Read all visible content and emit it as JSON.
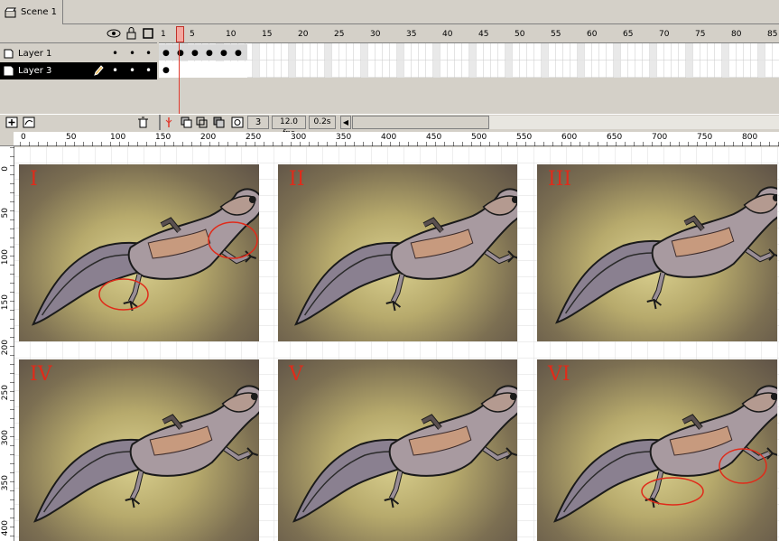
{
  "tab": {
    "scene_label": "Scene 1"
  },
  "layers": [
    {
      "name": "Layer 1",
      "selected": false
    },
    {
      "name": "Layer 3",
      "selected": true
    }
  ],
  "frame_ruler": [
    "1",
    "5",
    "10",
    "15",
    "20",
    "25",
    "30",
    "35",
    "40",
    "45",
    "50",
    "55",
    "60",
    "65",
    "70",
    "75",
    "80",
    "85"
  ],
  "status": {
    "current_frame": "3",
    "fps": "12.0 fps",
    "time": "0.2s"
  },
  "stage_ruler_top": [
    "0",
    "50",
    "100",
    "150",
    "200",
    "250",
    "300",
    "350",
    "400",
    "450",
    "500",
    "550",
    "600",
    "650",
    "700",
    "750",
    "800"
  ],
  "stage_ruler_left": [
    "0",
    "50",
    "100",
    "150",
    "200",
    "250",
    "300",
    "350",
    "400"
  ],
  "panels": [
    {
      "label": "I",
      "circles": true
    },
    {
      "label": "II",
      "circles": false
    },
    {
      "label": "III",
      "circles": false
    },
    {
      "label": "IV",
      "circles": false
    },
    {
      "label": "V",
      "circles": false
    },
    {
      "label": "VI",
      "circles": true
    }
  ],
  "colors": {
    "panel_red_label": "#e02b1a",
    "playhead": "#e03a2e",
    "layer_selected_bg": "#000000"
  }
}
